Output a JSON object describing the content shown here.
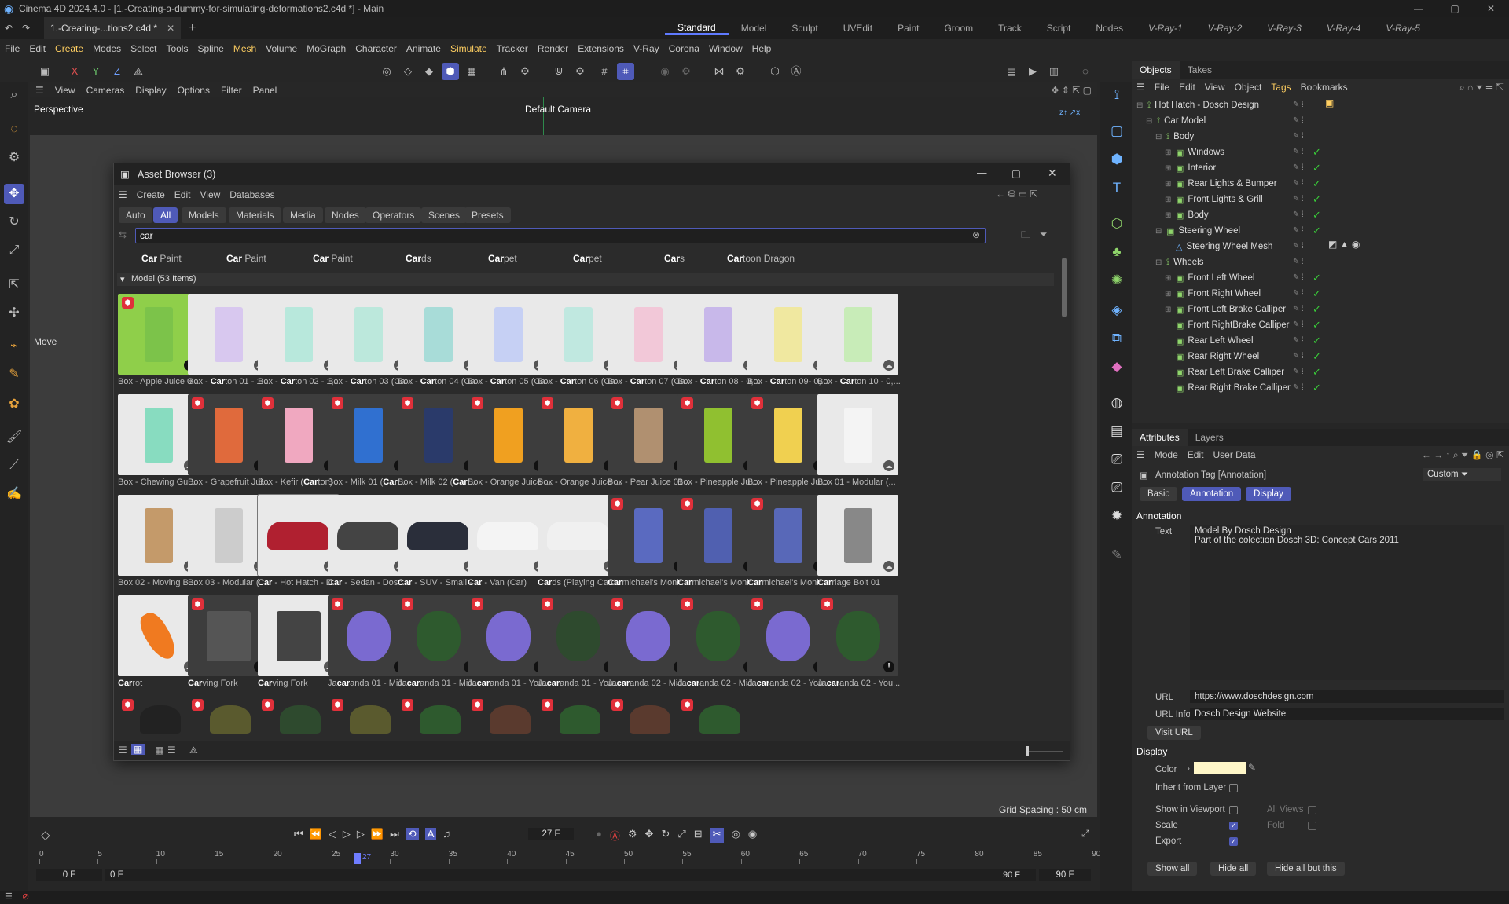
{
  "window": {
    "title": "Cinema 4D 2024.4.0 - [1.-Creating-a-dummy-for-simulating-deformations2.c4d *] - Main",
    "doc_tab": "1.-Creating-...tions2.c4d *"
  },
  "layouts": [
    "Standard",
    "Model",
    "Sculpt",
    "UVEdit",
    "Paint",
    "Groom",
    "Track",
    "Script",
    "Nodes",
    "V-Ray-1",
    "V-Ray-2",
    "V-Ray-3",
    "V-Ray-4",
    "V-Ray-5"
  ],
  "menu": [
    "File",
    "Edit",
    "Create",
    "Modes",
    "Select",
    "Tools",
    "Spline",
    "Mesh",
    "Volume",
    "MoGraph",
    "Character",
    "Animate",
    "Simulate",
    "Tracker",
    "Render",
    "Extensions",
    "V-Ray",
    "Corona",
    "Window",
    "Help"
  ],
  "viewport": {
    "menu": [
      "View",
      "Cameras",
      "Display",
      "Options",
      "Filter",
      "Panel"
    ],
    "label": "Perspective",
    "camera": "Default Camera",
    "grid": "Grid Spacing : 50 cm",
    "move": "Move"
  },
  "axes": {
    "x": "X",
    "y": "Y",
    "z": "Z"
  },
  "objects": {
    "tabs": [
      "Objects",
      "Takes"
    ],
    "menu": [
      "File",
      "Edit",
      "View",
      "Object",
      "Tags",
      "Bookmarks"
    ],
    "items": [
      {
        "name": "Hot Hatch - Dosch Design",
        "level": 0
      },
      {
        "name": "Car Model",
        "level": 1
      },
      {
        "name": "Body",
        "level": 2
      },
      {
        "name": "Windows",
        "level": 3
      },
      {
        "name": "Interior",
        "level": 3
      },
      {
        "name": "Rear Lights & Bumper",
        "level": 3
      },
      {
        "name": "Front Lights & Grill",
        "level": 3
      },
      {
        "name": "Body",
        "level": 3
      },
      {
        "name": "Steering Wheel",
        "level": 2
      },
      {
        "name": "Steering Wheel Mesh",
        "level": 3
      },
      {
        "name": "Wheels",
        "level": 2
      },
      {
        "name": "Front Left Wheel",
        "level": 3
      },
      {
        "name": "Front Right Wheel",
        "level": 3
      },
      {
        "name": "Front Left Brake Calliper",
        "level": 3
      },
      {
        "name": "Front RightBrake Calliper",
        "level": 3
      },
      {
        "name": "Rear Left Wheel",
        "level": 3
      },
      {
        "name": "Rear Right Wheel",
        "level": 3
      },
      {
        "name": "Rear Left Brake Calliper",
        "level": 3
      },
      {
        "name": "Rear Right Brake Calliper",
        "level": 3
      }
    ]
  },
  "attributes": {
    "tabs": [
      "Attributes",
      "Layers"
    ],
    "menu": [
      "Mode",
      "Edit",
      "User Data"
    ],
    "tag": "Annotation Tag [Annotation]",
    "preset": "Custom",
    "subtabs": [
      "Basic",
      "Annotation",
      "Display"
    ],
    "section": "Annotation",
    "text_label": "Text",
    "text_line1": "Model By Dosch Design",
    "text_line2": "Part of the colection Dosch 3D: Concept Cars 2011",
    "url_label": "URL",
    "url": "https://www.doschdesign.com",
    "urlinfo_label": "URL Info",
    "urlinfo": "Dosch Design Website",
    "visit": "Visit URL",
    "display_section": "Display",
    "color_label": "Color",
    "color": "#fff7c8",
    "inherit": "Inherit from Layer",
    "show_vp": "Show in Viewport",
    "all_views": "All Views",
    "scale": "Scale",
    "fold": "Fold",
    "export": "Export",
    "buttons": [
      "Show all",
      "Hide all",
      "Hide all but this"
    ]
  },
  "timeline": {
    "frame": "27 F",
    "start": "0 F",
    "start2": "0 F",
    "end": "90 F",
    "end2": "90 F",
    "ticks": [
      "0",
      "5",
      "10",
      "15",
      "20",
      "25",
      "30",
      "35",
      "40",
      "45",
      "50",
      "55",
      "60",
      "65",
      "70",
      "75",
      "80",
      "85",
      "90"
    ],
    "current": "27"
  },
  "asset": {
    "title": "Asset Browser (3)",
    "menu": [
      "Create",
      "Edit",
      "View",
      "Databases"
    ],
    "filters": [
      "Auto",
      "All",
      "Models",
      "Materials",
      "Media",
      "Nodes",
      "Operators",
      "Scenes",
      "Presets"
    ],
    "search": "car",
    "suggestions": [
      [
        "Car",
        " Paint"
      ],
      [
        "Car",
        " Paint"
      ],
      [
        "Car",
        " Paint"
      ],
      [
        "Car",
        "ds"
      ],
      [
        "Car",
        "pet"
      ],
      [
        "Car",
        "pet"
      ],
      [
        "Car",
        "s"
      ],
      [
        "Car",
        "toon Dragon"
      ]
    ],
    "group": "Model (53 Items)",
    "rows": [
      [
        [
          "Box - Apple Juice 0..."
        ],
        [
          "Box - ",
          "Car",
          "ton 01 - 1..."
        ],
        [
          "Box - ",
          "Car",
          "ton 02 - 1,..."
        ],
        [
          "Box - ",
          "Car",
          "ton 03 (Ca..."
        ],
        [
          "Box - ",
          "Car",
          "ton 04 (Ca..."
        ],
        [
          "Box - ",
          "Car",
          "ton 05 (Ca..."
        ],
        [
          "Box - ",
          "Car",
          "ton 06 (Ca..."
        ],
        [
          "Box - ",
          "Car",
          "ton 07 (Ca..."
        ],
        [
          "Box - ",
          "Car",
          "ton 08 - 0,..."
        ],
        [
          "Box - ",
          "Car",
          "ton 09- 0,..."
        ],
        [
          "Box - ",
          "Car",
          "ton 10 - 0,..."
        ]
      ],
      [
        [
          "Box - Chewing Gu..."
        ],
        [
          "Box - Grapefruit Jui..."
        ],
        [
          "Box - Kefir (",
          "Car",
          "ton)"
        ],
        [
          "Box - Milk 01 (",
          "Car",
          "t..."
        ],
        [
          "Box - Milk 02 (",
          "Car",
          "t..."
        ],
        [
          "Box - Orange Juice ..."
        ],
        [
          "Box - Orange Juice ..."
        ],
        [
          "Box - Pear Juice 01 ..."
        ],
        [
          "Box - Pineapple Jui..."
        ],
        [
          "Box - Pineapple Jul..."
        ],
        [
          "Box 01 - Modular (..."
        ]
      ],
      [
        [
          "Box 02 - Moving B..."
        ],
        [
          "Box 03 - Modular (..."
        ],
        [
          "",
          "Car",
          " - Hot Hatch - D..."
        ],
        [
          "",
          "Car",
          " - Sedan - Dosc..."
        ],
        [
          "",
          "Car",
          " - SUV - Small - ..."
        ],
        [
          "",
          "Car",
          " - Van (Car)"
        ],
        [
          "",
          "Car",
          "ds (Playing Card..."
        ],
        [
          "",
          "Car",
          "michael's Monk..."
        ],
        [
          "",
          "Car",
          "michael's Monk..."
        ],
        [
          "",
          "Car",
          "michael's Monk..."
        ],
        [
          "",
          "Car",
          "riage Bolt 01"
        ]
      ],
      [
        [
          "",
          "Car",
          "rot"
        ],
        [
          "",
          "Car",
          "ving Fork"
        ],
        [
          "",
          "Car",
          "ving Fork"
        ],
        [
          "Ja",
          "car",
          "anda 01 - Mid..."
        ],
        [
          "Ja",
          "car",
          "anda 01 - Mid..."
        ],
        [
          "Ja",
          "car",
          "anda 01 - You..."
        ],
        [
          "Ja",
          "car",
          "anda 01 - You..."
        ],
        [
          "Ja",
          "car",
          "anda 02 - Mid..."
        ],
        [
          "Ja",
          "car",
          "anda 02 - Mid..."
        ],
        [
          "Ja",
          "car",
          "anda 02 - You..."
        ],
        [
          "Ja",
          "car",
          "anda 02 - You..."
        ]
      ]
    ]
  }
}
